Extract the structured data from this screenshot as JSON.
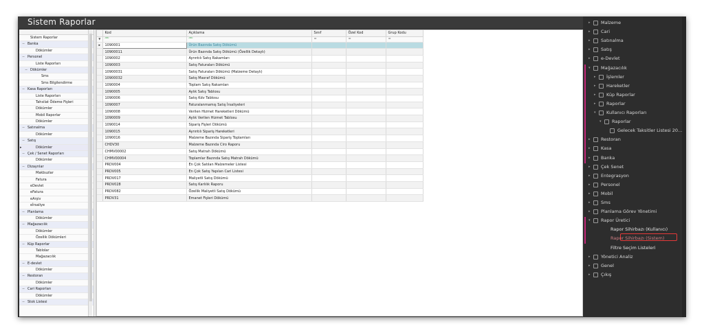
{
  "window": {
    "title": "Sistem Raporlar"
  },
  "tree": {
    "rows": [
      {
        "label": "Sistem Raporlar",
        "level": 1,
        "exp": ""
      },
      {
        "label": "Banka",
        "level": 0,
        "exp": "−",
        "hdr": true
      },
      {
        "label": "Dökümler",
        "level": 2,
        "exp": ""
      },
      {
        "label": "Personel",
        "level": 0,
        "exp": "−",
        "hdr": true
      },
      {
        "label": "Liste Raporları",
        "level": 2,
        "exp": ""
      },
      {
        "label": "Dökümler",
        "level": 1,
        "exp": "−",
        "hdr": true
      },
      {
        "label": "Sms",
        "level": 3,
        "exp": ""
      },
      {
        "label": "Sms Bilgilendirme",
        "level": 3,
        "exp": ""
      },
      {
        "label": "Kasa Raporları",
        "level": 0,
        "exp": "−",
        "hdr": true
      },
      {
        "label": "Liste Raporları",
        "level": 2,
        "exp": ""
      },
      {
        "label": "Tahsilat Ödeme Fişleri",
        "level": 2,
        "exp": ""
      },
      {
        "label": "Dökümler",
        "level": 2,
        "exp": ""
      },
      {
        "label": "Mobil Raporlar",
        "level": 2,
        "exp": ""
      },
      {
        "label": "Dökümler",
        "level": 2,
        "exp": ""
      },
      {
        "label": "Satınalma",
        "level": 0,
        "exp": "−",
        "hdr": true
      },
      {
        "label": "Dökümler",
        "level": 2,
        "exp": ""
      },
      {
        "label": "Satış",
        "level": 0,
        "exp": "−",
        "hdr": true
      },
      {
        "label": "Dökümler",
        "level": 2,
        "exp": "",
        "sel": true,
        "marker": true
      },
      {
        "label": "Çek / Senet Raporları",
        "level": 0,
        "exp": "−",
        "hdr": true
      },
      {
        "label": "Dökümler",
        "level": 2,
        "exp": ""
      },
      {
        "label": "Dizayn​lar",
        "level": 0,
        "exp": "−",
        "hdr": true
      },
      {
        "label": "Makbuzlar",
        "level": 2,
        "exp": ""
      },
      {
        "label": "Fatura",
        "level": 2,
        "exp": ""
      },
      {
        "label": "eDevlet",
        "level": 1,
        "exp": ""
      },
      {
        "label": "eFatura",
        "level": 1,
        "exp": ""
      },
      {
        "label": "eArşiv",
        "level": 1,
        "exp": ""
      },
      {
        "label": "eİrsaliye",
        "level": 1,
        "exp": ""
      },
      {
        "label": "Planlama",
        "level": 0,
        "exp": "−",
        "hdr": true
      },
      {
        "label": "Dökümler",
        "level": 2,
        "exp": ""
      },
      {
        "label": "Mağazacılık",
        "level": 0,
        "exp": "−",
        "hdr": true
      },
      {
        "label": "Dökümler",
        "level": 2,
        "exp": ""
      },
      {
        "label": "Özellik Dökümleri",
        "level": 2,
        "exp": ""
      },
      {
        "label": "Küp Raporlar",
        "level": 0,
        "exp": "−",
        "hdr": true
      },
      {
        "label": "Tablolar",
        "level": 2,
        "exp": ""
      },
      {
        "label": "Mağazacılık",
        "level": 2,
        "exp": ""
      },
      {
        "label": "E-devlet",
        "level": 0,
        "exp": "−",
        "hdr": true
      },
      {
        "label": "Dökümler",
        "level": 2,
        "exp": ""
      },
      {
        "label": "Restoran",
        "level": 0,
        "exp": "−",
        "hdr": true
      },
      {
        "label": "Dökümler",
        "level": 2,
        "exp": ""
      },
      {
        "label": "Cari Raporları",
        "level": 0,
        "exp": "−",
        "hdr": true
      },
      {
        "label": "Dökümler",
        "level": 2,
        "exp": ""
      },
      {
        "label": "Stok Listesi",
        "level": 0,
        "exp": "−",
        "hdr": true
      }
    ]
  },
  "grid": {
    "columns": [
      "Kod",
      "Açıklama",
      "Sınıf",
      "Özel Kod",
      "Grup Kodu"
    ],
    "filter_eq": "=",
    "rows": [
      {
        "kod": "1090001",
        "ad": "Ürün Bazında Satış Dökümü",
        "sel": true
      },
      {
        "kod": "10900011",
        "ad": "Ürün Bazında Satış Dökümü (Özellik Detaylı)"
      },
      {
        "kod": "1090002",
        "ad": "Ayrıntılı Satış Rakamları"
      },
      {
        "kod": "1090003",
        "ad": "Satış Faturaları Dökümü"
      },
      {
        "kod": "10900031",
        "ad": "Satış Faturaları Dökümü (Malzeme Detaylı)"
      },
      {
        "kod": "10900032",
        "ad": "Satış Masraf Dökümü"
      },
      {
        "kod": "1090004",
        "ad": "Toplam Satış Rakamları"
      },
      {
        "kod": "1090005",
        "ad": "Aylık Satış Tablosu"
      },
      {
        "kod": "1090006",
        "ad": "Satış Kdv Tablosu"
      },
      {
        "kod": "1090007",
        "ad": "Faturalanmamış Satış İrsaliyeleri"
      },
      {
        "kod": "1090008",
        "ad": "Verilen Hizmet Hareketleri Dökümü"
      },
      {
        "kod": "1090009",
        "ad": "Aylık Verilen Hizmet Tablosu"
      },
      {
        "kod": "1090014",
        "ad": "Sipariş Fişleri Dökümü"
      },
      {
        "kod": "1090015",
        "ad": "Ayrıntılı Sipariş Hareketleri"
      },
      {
        "kod": "1090016",
        "ad": "Malzeme Bazında Sipariş Toplamları"
      },
      {
        "kod": "CHDV30",
        "ad": "Malzeme Bazında Ciro Raporu"
      },
      {
        "kod": "CHMV00002",
        "ad": "Satış Matrah Dökümü"
      },
      {
        "kod": "CHMV00004",
        "ad": "Toplamlar Bazında Satış Matrah Dökümü"
      },
      {
        "kod": "PRDV004",
        "ad": "En Çok Satılan Malzemeler Listesi"
      },
      {
        "kod": "PRDV005",
        "ad": "En Çok Satış Yapılan Cari Listesi"
      },
      {
        "kod": "PRDV017",
        "ad": "Maliyetli Satış Dökümü"
      },
      {
        "kod": "PRDV028",
        "ad": "Satış Karlılık Raporu"
      },
      {
        "kod": "PRDV082",
        "ad": "Özellik Maliyetli Satış Dökümü"
      },
      {
        "kod": "PRDV31",
        "ad": "Emanet Fişleri Dökümü"
      }
    ]
  },
  "nav": {
    "items": [
      {
        "label": "Malzeme",
        "indent": 0,
        "arrow": "▸"
      },
      {
        "label": "Cari",
        "indent": 0,
        "arrow": "▸"
      },
      {
        "label": "Satınalma",
        "indent": 0,
        "arrow": "▸"
      },
      {
        "label": "Satış",
        "indent": 0,
        "arrow": "▸"
      },
      {
        "label": "e-Devlet",
        "indent": 0,
        "arrow": "▸"
      },
      {
        "label": "Mağazacılık",
        "indent": 0,
        "arrow": "▾"
      },
      {
        "label": "İşlemler",
        "indent": 1,
        "arrow": "▸"
      },
      {
        "label": "Hareketler",
        "indent": 1,
        "arrow": "▸"
      },
      {
        "label": "Küp Raporlar",
        "indent": 1,
        "arrow": "▸"
      },
      {
        "label": "Raporlar",
        "indent": 1,
        "arrow": "▸"
      },
      {
        "label": "Kullanıcı Raporları",
        "indent": 1,
        "arrow": "▾"
      },
      {
        "label": "Raporlar",
        "indent": 2,
        "arrow": "▾"
      },
      {
        "label": "Gelecek Taksitler Listesi 20...",
        "indent": 3,
        "arrow": ""
      },
      {
        "label": "Restoran",
        "indent": 0,
        "arrow": "▸"
      },
      {
        "label": "Kasa",
        "indent": 0,
        "arrow": "▸"
      },
      {
        "label": "Banka",
        "indent": 0,
        "arrow": "▸"
      },
      {
        "label": "Çek Senet",
        "indent": 0,
        "arrow": "▸"
      },
      {
        "label": "Entegrasyon",
        "indent": 0,
        "arrow": "▸"
      },
      {
        "label": "Personel",
        "indent": 0,
        "arrow": "▸"
      },
      {
        "label": "Mobil",
        "indent": 0,
        "arrow": "▸"
      },
      {
        "label": "Sms",
        "indent": 0,
        "arrow": "▸"
      },
      {
        "label": "Planlama Görev Yönetimi",
        "indent": 0,
        "arrow": "▸"
      },
      {
        "label": "Rapor Üretici",
        "indent": 0,
        "arrow": "▾"
      },
      {
        "label": "Rapor Sihirbazı (Kullanıcı)",
        "indent": 1,
        "arrow": "",
        "plain": true
      },
      {
        "label": "Rapor Sihirbazı (Sistem)",
        "indent": 1,
        "arrow": "",
        "plain": true,
        "active": true
      },
      {
        "label": "Filtre Seçim Listeleri",
        "indent": 1,
        "arrow": "",
        "plain": true
      },
      {
        "label": "Yönetici Analiz",
        "indent": 0,
        "arrow": "▸"
      },
      {
        "label": "Genel",
        "indent": 0,
        "arrow": "▸"
      },
      {
        "label": "Çıkış",
        "indent": 0,
        "arrow": "▸"
      }
    ]
  },
  "colors": {
    "accent_pink": "#c6287a",
    "highlight_red": "#e53939",
    "selection": "#b9dbe2"
  }
}
